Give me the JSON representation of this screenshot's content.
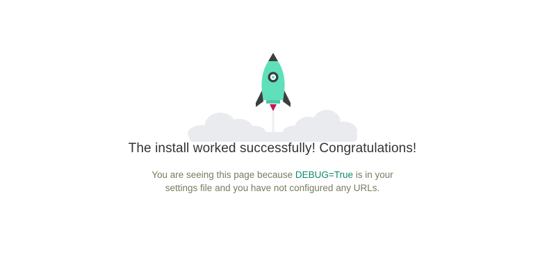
{
  "headline": "The install worked successfully! Congratulations!",
  "message": {
    "before": "You are seeing this page because ",
    "debug_flag": "DEBUG=True",
    "after": " is in your settings file and you have not configured any URLs."
  },
  "icons": {
    "rocket": "rocket-icon",
    "clouds": "cloud-icon"
  },
  "colors": {
    "rocket_body": "#5fe0bb",
    "rocket_dark": "#3a3f3d",
    "rocket_flame": "#c2185b",
    "cloud": "#e9ebef",
    "headline": "#333333",
    "body_text": "#7a7a60",
    "debug_highlight": "#0c8a6a"
  }
}
